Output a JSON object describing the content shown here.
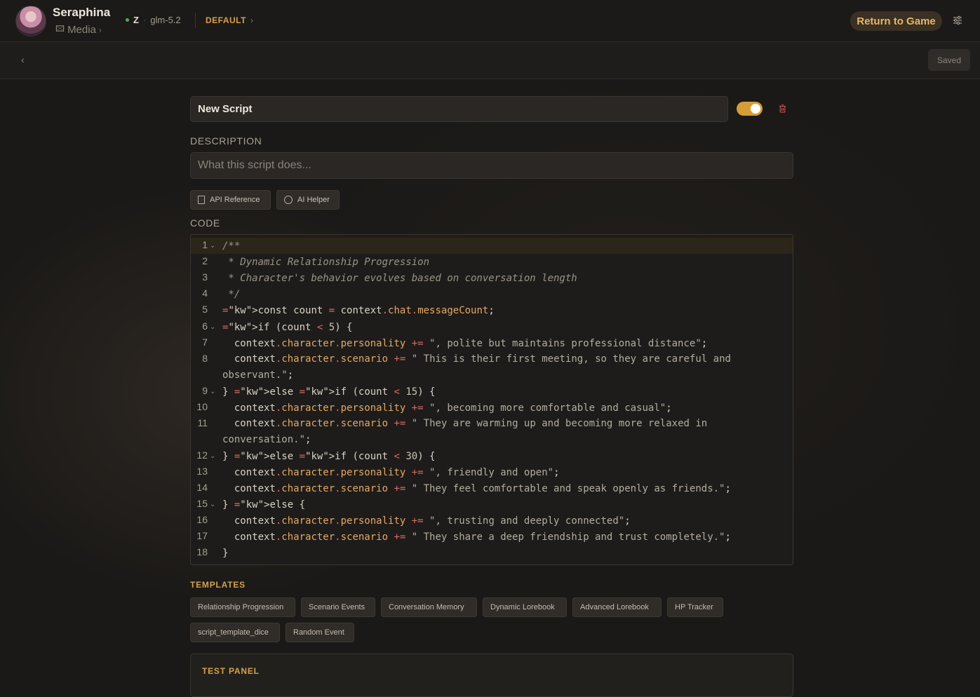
{
  "header": {
    "character_name": "Seraphina",
    "media_label": "Media",
    "provider": "Z",
    "model": "glm-5.2",
    "preset": "DEFAULT",
    "return_label": "Return to Game"
  },
  "subbar": {
    "saved_label": "Saved"
  },
  "form": {
    "script_name": "New Script",
    "enabled": true,
    "description_label": "DESCRIPTION",
    "description_placeholder": "What this script does...",
    "api_reference_label": "API Reference",
    "ai_helper_label": "AI Helper",
    "code_label": "CODE"
  },
  "code_lines": [
    "/**",
    " * Dynamic Relationship Progression",
    " * Character's behavior evolves based on conversation length",
    " */",
    "const count = context.chat.messageCount;",
    "if (count < 5) {",
    "  context.character.personality += \", polite but maintains professional distance\";",
    "  context.character.scenario += \" This is their first meeting, so they are careful and observant.\";",
    "} else if (count < 15) {",
    "  context.character.personality += \", becoming more comfortable and casual\";",
    "  context.character.scenario += \" They are warming up and becoming more relaxed in conversation.\";",
    "} else if (count < 30) {",
    "  context.character.personality += \", friendly and open\";",
    "  context.character.scenario += \" They feel comfortable and speak openly as friends.\";",
    "} else {",
    "  context.character.personality += \", trusting and deeply connected\";",
    "  context.character.scenario += \" They share a deep friendship and trust completely.\";",
    "}"
  ],
  "templates": {
    "title": "TEMPLATES",
    "items": [
      "Relationship Progression",
      "Scenario Events",
      "Conversation Memory",
      "Dynamic Lorebook",
      "Advanced Lorebook",
      "HP Tracker",
      "script_template_dice",
      "Random Event"
    ]
  },
  "test_panel": {
    "title": "TEST PANEL"
  },
  "colors": {
    "accent": "#d49d36",
    "background": "#1b1917"
  }
}
